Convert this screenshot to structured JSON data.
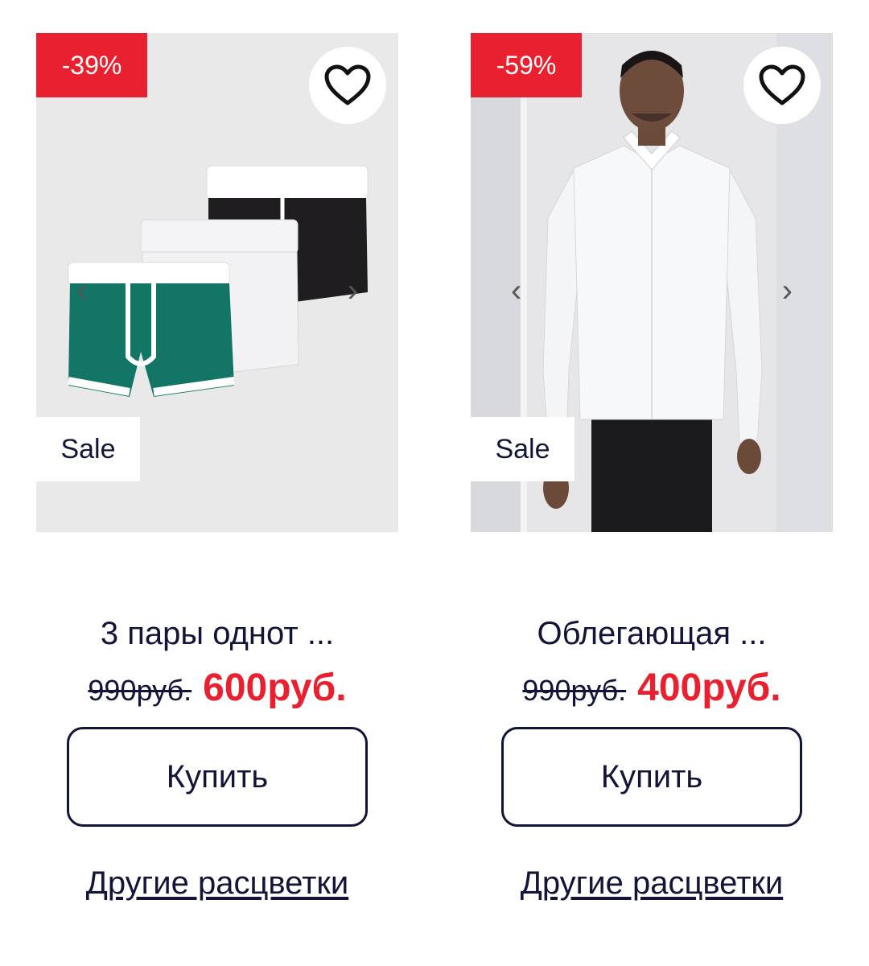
{
  "products": [
    {
      "discount": "-39%",
      "sale_tag": "Sale",
      "title": "3 пары однот ...",
      "old_price": "990руб.",
      "new_price": "600руб.",
      "buy_label": "Купить",
      "other_colors": "Другие расцветки",
      "prev_arrow": "‹",
      "next_arrow": "›",
      "image": "three-boxer-briefs"
    },
    {
      "discount": "-59%",
      "sale_tag": "Sale",
      "title": "Облегающая ...",
      "old_price": "990руб.",
      "new_price": "400руб.",
      "buy_label": "Купить",
      "other_colors": "Другие расцветки",
      "prev_arrow": "‹",
      "next_arrow": "›",
      "image": "man-in-white-shirt"
    }
  ],
  "icons": {
    "favorite": "heart-outline-icon"
  },
  "colors": {
    "accent": "#e8202f",
    "text": "#121438",
    "image_bg": "#e9e9ea"
  }
}
